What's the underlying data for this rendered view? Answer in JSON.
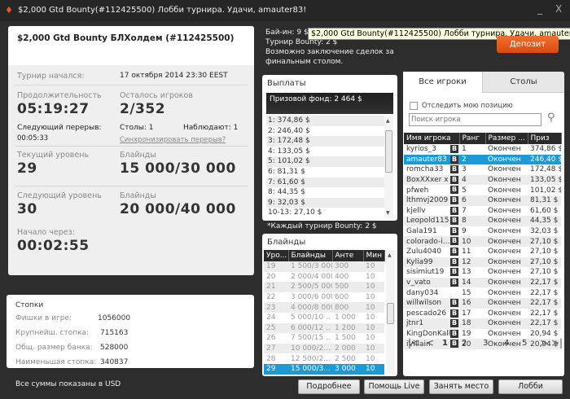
{
  "window": {
    "title": "$2,000 Gtd Bounty(#112425500) Лобби турнира. Удачи, amauter83!",
    "minimize": "_",
    "close": "X"
  },
  "tooltip": "$2,000 Gtd Bounty(#112425500) Лобби турнира. Удачи, amauter83!",
  "tournament": {
    "name": "$2,000 Gtd Bounty БЛХолдем (#112425500)",
    "started_label": "Турнир начался:",
    "started_value": "17 октября 2014  23:30 EEST",
    "duration_label": "Продолжительность",
    "duration_value": "05:19:27",
    "remaining_label": "Осталось игроков",
    "remaining_value": "2/352",
    "next_break_label": "Следующий перерыв:",
    "next_break_value": "00:05:33",
    "tables": "Столы: 1",
    "observers": "Наблюдают: 1",
    "sync_link": "Синхронизировать перерыв?",
    "current_level_label": "Текущий уровень",
    "current_level": "29",
    "blinds_label": "Блайнды",
    "current_blinds": "15 000/30 000",
    "next_level_label": "Следующий уровень",
    "next_level": "30",
    "next_blinds": "20 000/40 000",
    "start_in_label": "Начало через:",
    "start_in_value": "00:02:55"
  },
  "stacks": {
    "title": "Стопки",
    "rows": [
      {
        "label": "Фишки в игре:",
        "value": "1056000"
      },
      {
        "label": "Крупнейш. стопка:",
        "value": "715163"
      },
      {
        "label": "Общ. размер банка:",
        "value": "528000"
      },
      {
        "label": "Наименьшая стопка:",
        "value": "340837"
      }
    ]
  },
  "footnote": "Все суммы показаны в USD",
  "info": {
    "buyin": "Бай-ин: 9 $+",
    "bounty": "Турнир Bounty: 2 $",
    "deal1": "Возможно заключение сделок за",
    "deal2": "финальным столом."
  },
  "deposit_label": "Депозит",
  "payouts": {
    "title": "Выплаты",
    "prize_pool": "Призовой фонд: 2 464 $",
    "items": [
      "1: 374,86 $",
      "2: 246,40 $",
      "3: 172,48 $",
      "4: 133,05 $",
      "5: 101,02 $",
      "6: 81,31 $",
      "7: 61,60 $",
      "8: 44,35 $",
      "9: 32,03 $",
      "10-13: 27,10 $"
    ],
    "bounty_note": "*Каждый турнир Bounty: 2 $"
  },
  "blinds": {
    "title": "Блайнды",
    "columns": [
      "Уро...",
      "Блайнды",
      "Анте",
      "Мин"
    ],
    "rows": [
      [
        "19",
        "1 500/3 000",
        "300",
        "10"
      ],
      [
        "20",
        "2 000/4 000",
        "400",
        "10"
      ],
      [
        "21",
        "2 500/5 000",
        "500",
        "10"
      ],
      [
        "22",
        "3 000/6 000",
        "600",
        "10"
      ],
      [
        "23",
        "4 000/8 000",
        "800",
        "10"
      ],
      [
        "24",
        "5 000/10 ..",
        "1 000",
        "10"
      ],
      [
        "25",
        "6 000/12 ..",
        "1 200",
        "10"
      ],
      [
        "26",
        "7 500/15 ..",
        "1 500",
        "10"
      ],
      [
        "27",
        "10 000/2...",
        "2 000",
        "10"
      ],
      [
        "28",
        "12 500/2...",
        "2 500",
        "10"
      ],
      [
        "29",
        "15 000/3...",
        "3 000",
        "10"
      ]
    ],
    "selected": 10
  },
  "players": {
    "tabs": [
      "Все игроки",
      "Столы"
    ],
    "track_label": "Отследить мою позицию",
    "search_placeholder": "Поиск игрока",
    "columns": [
      "Имя игрока",
      "Ранг",
      "Размер ...",
      "Приз"
    ],
    "rows": [
      [
        "kyrios_3",
        "B",
        "1",
        "Окончен",
        "374,86 $"
      ],
      [
        "amauter83",
        "B",
        "2",
        "Окончен",
        "246,40 $"
      ],
      [
        "romcha33",
        "B",
        "3",
        "Окончен",
        "172,48 $"
      ],
      [
        "BoxXXxer x",
        "B",
        "4",
        "Окончен",
        "133,05 $"
      ],
      [
        "pfweh",
        "B",
        "5",
        "Окончен",
        "101,02 $"
      ],
      [
        "lthmvj2009",
        "B",
        "6",
        "Окончен",
        "81,31 $"
      ],
      [
        "kjellv",
        "B",
        "7",
        "Окончен",
        "61,60 $"
      ],
      [
        "Leopold115",
        "B",
        "8",
        "Окончен",
        "44,35 $"
      ],
      [
        "Gala191",
        "B",
        "9",
        "Окончен",
        "32,03 $"
      ],
      [
        "colorado-i...",
        "B",
        "10",
        "Окончен",
        "27,10 $"
      ],
      [
        "Zulu4040",
        "B",
        "11",
        "Окончен",
        "27,10 $"
      ],
      [
        "Kylia99",
        "B",
        "12",
        "Окончен",
        "27,10 $"
      ],
      [
        "sisimiut19",
        "B",
        "13",
        "Окончен",
        "27,10 $"
      ],
      [
        "v_vato",
        "B",
        "14",
        "Окончен",
        "22,17 $"
      ],
      [
        "dany034",
        "",
        "15",
        "Окончен",
        "22,17 $"
      ],
      [
        "willwilson",
        "B",
        "16",
        "Окончен",
        "22,17 $"
      ],
      [
        "pescado26",
        "B",
        "17",
        "Окончен",
        "22,17 $"
      ],
      [
        "jtnr1",
        "B",
        "18",
        "Окончен",
        "22,17 $"
      ],
      [
        "KingDonKalle",
        "B",
        "19",
        "Окончен",
        "20,94 $"
      ],
      [
        "iVillain",
        "B",
        "20",
        "Окончен",
        "20,94 $"
      ]
    ],
    "selected": 1,
    "pages": [
      "1",
      "2",
      "3",
      "4",
      "5"
    ]
  },
  "buttons": {
    "details": "Подробнее",
    "help": "Помощь Live",
    "take_seat": "Занять место",
    "lobby": "Лобби"
  },
  "colors": {
    "accent": "#1a9ad6",
    "deposit": "#e85b1a"
  }
}
